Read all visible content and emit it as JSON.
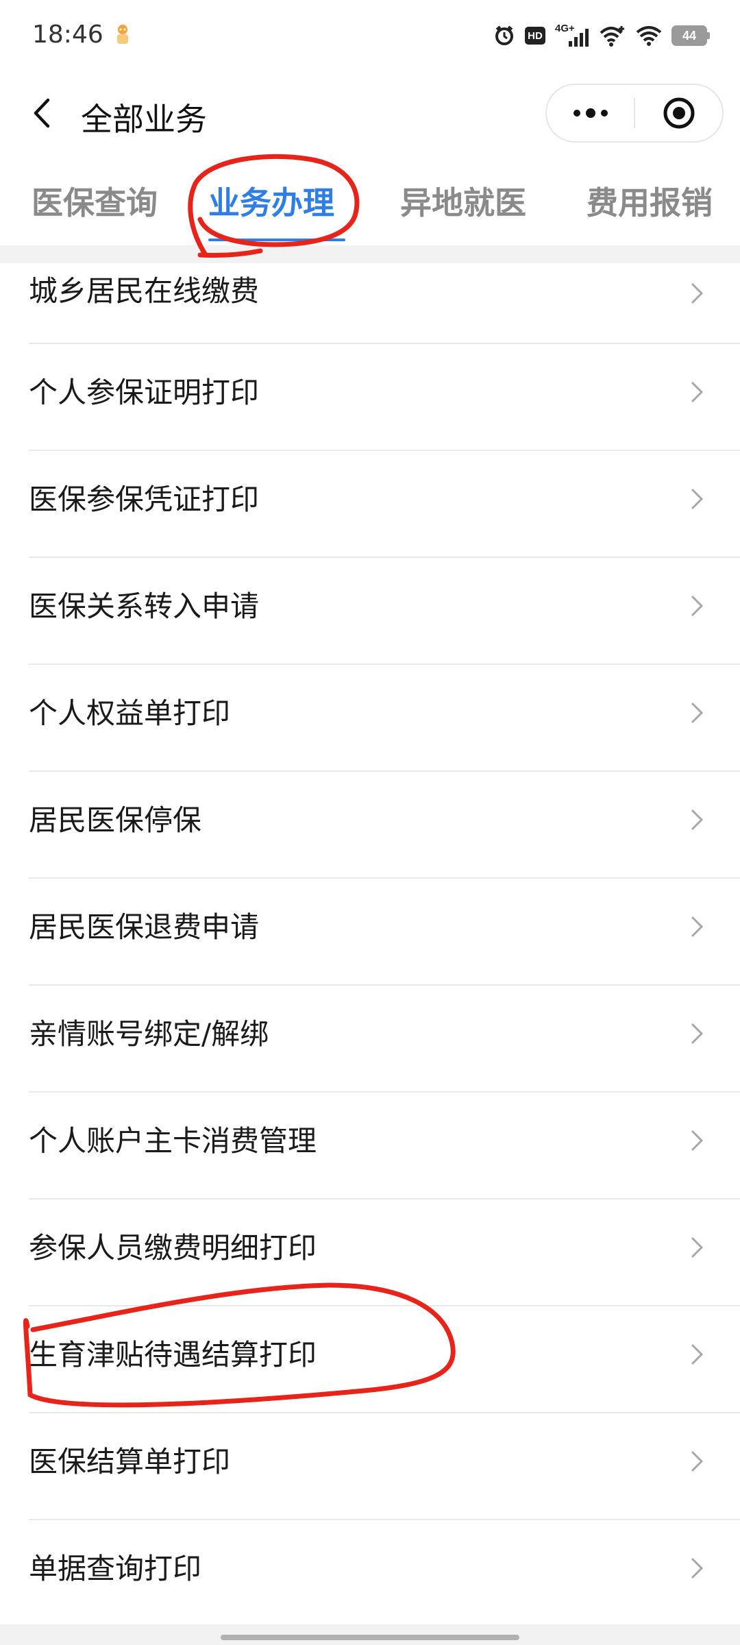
{
  "status_bar": {
    "time": "18:46",
    "hd": "HD",
    "network": "4G+",
    "battery": "44"
  },
  "nav": {
    "title": "全部业务"
  },
  "tabs": [
    {
      "label": "医保查询"
    },
    {
      "label": "业务办理"
    },
    {
      "label": "异地就医"
    },
    {
      "label": "费用报销"
    }
  ],
  "active_tab": "业务办理",
  "items": [
    {
      "label": "城乡居民在线缴费"
    },
    {
      "label": "个人参保证明打印"
    },
    {
      "label": "医保参保凭证打印"
    },
    {
      "label": "医保关系转入申请"
    },
    {
      "label": "个人权益单打印"
    },
    {
      "label": "居民医保停保"
    },
    {
      "label": "居民医保退费申请"
    },
    {
      "label": "亲情账号绑定/解绑"
    },
    {
      "label": "个人账户主卡消费管理"
    },
    {
      "label": "参保人员缴费明细打印"
    },
    {
      "label": "生育津贴待遇结算打印"
    },
    {
      "label": "医保结算单打印"
    },
    {
      "label": "单据查询打印"
    }
  ],
  "colors": {
    "accent": "#2f7ee8",
    "annotation": "#e8231a",
    "inactive_tab": "#8a8a8a"
  }
}
